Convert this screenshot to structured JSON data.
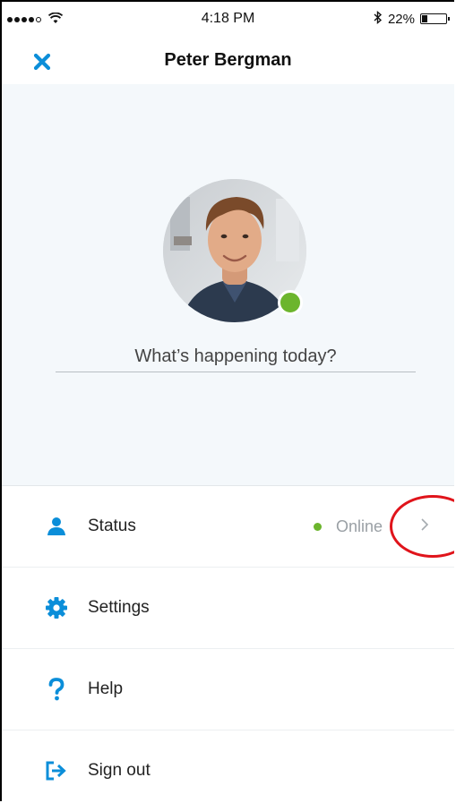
{
  "statusbar": {
    "time": "4:18 PM",
    "battery": "22%",
    "battery_fraction": 0.22,
    "signal_icon": "signal-dots-icon",
    "wifi_icon": "wifi-icon",
    "bluetooth_icon": "bluetooth-icon"
  },
  "header": {
    "title": "Peter Bergman",
    "close_icon": "close-icon"
  },
  "profile": {
    "mood_placeholder": "What’s happening today?",
    "presence_color": "#6cb52d"
  },
  "menu": {
    "items": [
      {
        "label": "Status",
        "icon": "person-icon",
        "value": "Online"
      },
      {
        "label": "Settings",
        "icon": "gear-icon"
      },
      {
        "label": "Help",
        "icon": "question-icon"
      },
      {
        "label": "Sign out",
        "icon": "sign-out-icon"
      }
    ]
  },
  "colors": {
    "accent": "#0b8ed9",
    "online": "#6cb52d",
    "annotation": "#e0141b"
  }
}
